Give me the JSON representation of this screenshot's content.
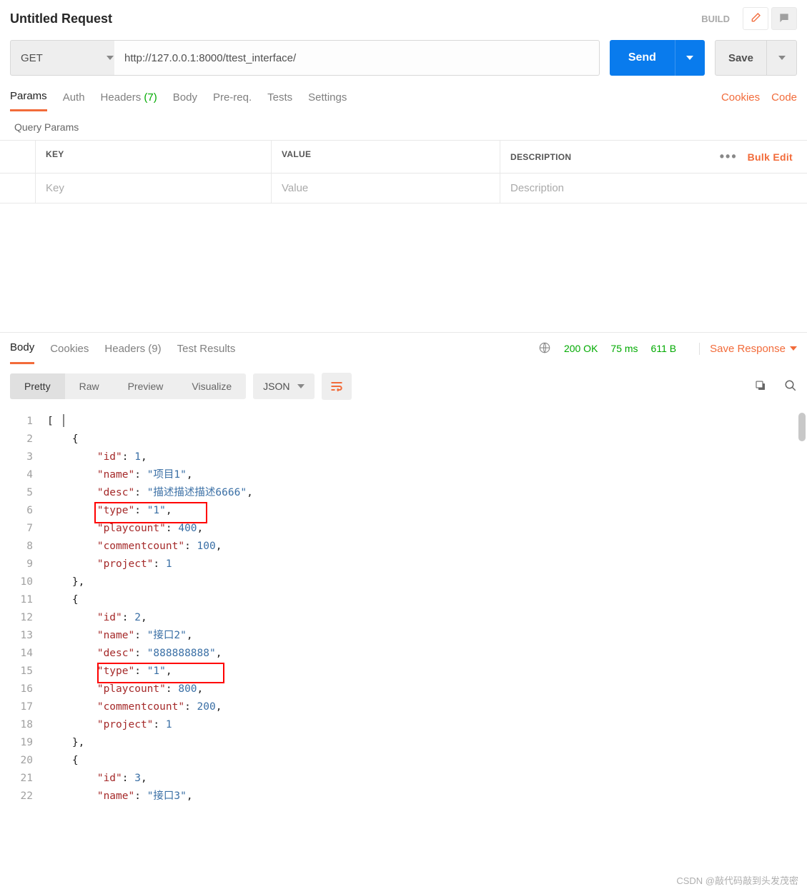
{
  "header": {
    "title": "Untitled Request",
    "build": "BUILD"
  },
  "request": {
    "method": "GET",
    "url": "http://127.0.0.1:8000/ttest_interface/",
    "send": "Send",
    "save": "Save"
  },
  "reqTabs": {
    "params": "Params",
    "auth": "Auth",
    "headers": "Headers",
    "headers_count": "(7)",
    "body": "Body",
    "prereq": "Pre-req.",
    "tests": "Tests",
    "settings": "Settings",
    "cookies": "Cookies",
    "code": "Code"
  },
  "queryParams": {
    "label": "Query Params",
    "key": "KEY",
    "value": "VALUE",
    "description": "DESCRIPTION",
    "bulk": "Bulk Edit",
    "ph_key": "Key",
    "ph_value": "Value",
    "ph_desc": "Description"
  },
  "respTabs": {
    "body": "Body",
    "cookies": "Cookies",
    "headers": "Headers",
    "headers_count": "(9)",
    "test": "Test Results"
  },
  "respStatus": {
    "status": "200 OK",
    "time": "75 ms",
    "size": "611 B",
    "save": "Save Response"
  },
  "format": {
    "pretty": "Pretty",
    "raw": "Raw",
    "preview": "Preview",
    "visualize": "Visualize",
    "json": "JSON"
  },
  "code": [
    {
      "n": "1",
      "indent": 0,
      "html": "<span class='punct'>[</span>"
    },
    {
      "n": "2",
      "indent": 1,
      "html": "<span class='punct'>{</span>"
    },
    {
      "n": "3",
      "indent": 2,
      "html": "<span class='key'>\"id\"</span><span class='punct'>: </span><span class='number'>1</span><span class='punct'>,</span>"
    },
    {
      "n": "4",
      "indent": 2,
      "html": "<span class='key'>\"name\"</span><span class='punct'>: </span><span class='string'>\"项目1\"</span><span class='punct'>,</span>"
    },
    {
      "n": "5",
      "indent": 2,
      "html": "<span class='key'>\"desc\"</span><span class='punct'>: </span><span class='string'>\"描述描述描述6666\"</span><span class='punct'>,</span>"
    },
    {
      "n": "6",
      "indent": 2,
      "html": "<span class='key'>\"type\"</span><span class='punct'>: </span><span class='string'>\"1\"</span><span class='punct'>,</span>"
    },
    {
      "n": "7",
      "indent": 2,
      "html": "<span class='key'>\"playcount\"</span><span class='punct'>: </span><span class='number'>400</span><span class='punct'>,</span>"
    },
    {
      "n": "8",
      "indent": 2,
      "html": "<span class='key'>\"commentcount\"</span><span class='punct'>: </span><span class='number'>100</span><span class='punct'>,</span>"
    },
    {
      "n": "9",
      "indent": 2,
      "html": "<span class='key'>\"project\"</span><span class='punct'>: </span><span class='number'>1</span>"
    },
    {
      "n": "10",
      "indent": 1,
      "html": "<span class='punct'>},</span>"
    },
    {
      "n": "11",
      "indent": 1,
      "html": "<span class='punct'>{</span>"
    },
    {
      "n": "12",
      "indent": 2,
      "html": "<span class='key'>\"id\"</span><span class='punct'>: </span><span class='number'>2</span><span class='punct'>,</span>"
    },
    {
      "n": "13",
      "indent": 2,
      "html": "<span class='key'>\"name\"</span><span class='punct'>: </span><span class='string'>\"接口2\"</span><span class='punct'>,</span>"
    },
    {
      "n": "14",
      "indent": 2,
      "html": "<span class='key'>\"desc\"</span><span class='punct'>: </span><span class='string'>\"888888888\"</span><span class='punct'>,</span>"
    },
    {
      "n": "15",
      "indent": 2,
      "html": "<span class='key'>\"type\"</span><span class='punct'>: </span><span class='string'>\"1\"</span><span class='punct'>,</span>"
    },
    {
      "n": "16",
      "indent": 2,
      "html": "<span class='key'>\"playcount\"</span><span class='punct'>: </span><span class='number'>800</span><span class='punct'>,</span>"
    },
    {
      "n": "17",
      "indent": 2,
      "html": "<span class='key'>\"commentcount\"</span><span class='punct'>: </span><span class='number'>200</span><span class='punct'>,</span>"
    },
    {
      "n": "18",
      "indent": 2,
      "html": "<span class='key'>\"project\"</span><span class='punct'>: </span><span class='number'>1</span>"
    },
    {
      "n": "19",
      "indent": 1,
      "html": "<span class='punct'>},</span>"
    },
    {
      "n": "20",
      "indent": 1,
      "html": "<span class='punct'>{</span>"
    },
    {
      "n": "21",
      "indent": 2,
      "html": "<span class='key'>\"id\"</span><span class='punct'>: </span><span class='number'>3</span><span class='punct'>,</span>"
    },
    {
      "n": "22",
      "indent": 2,
      "html": "<span class='key'>\"name\"</span><span class='punct'>: </span><span class='string'>\"接口3\"</span><span class='punct'>,</span>"
    }
  ],
  "watermark": "CSDN @敲代码敲到头发茂密"
}
